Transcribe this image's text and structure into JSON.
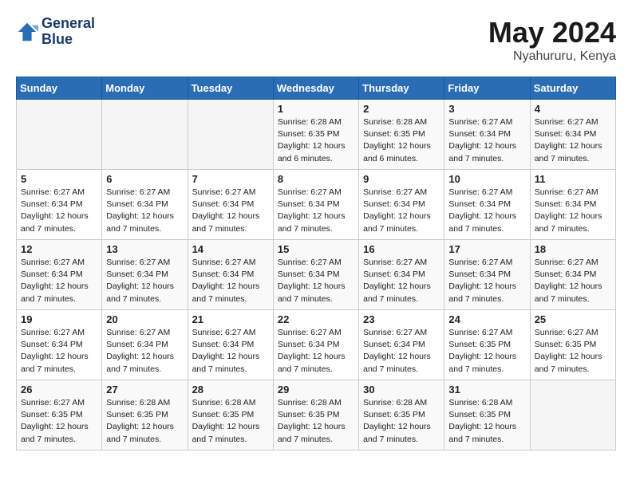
{
  "header": {
    "logo_line1": "General",
    "logo_line2": "Blue",
    "month": "May 2024",
    "location": "Nyahururu, Kenya"
  },
  "days_of_week": [
    "Sunday",
    "Monday",
    "Tuesday",
    "Wednesday",
    "Thursday",
    "Friday",
    "Saturday"
  ],
  "weeks": [
    [
      {
        "day": "",
        "content": ""
      },
      {
        "day": "",
        "content": ""
      },
      {
        "day": "",
        "content": ""
      },
      {
        "day": "1",
        "content": "Sunrise: 6:28 AM\nSunset: 6:35 PM\nDaylight: 12 hours\nand 6 minutes."
      },
      {
        "day": "2",
        "content": "Sunrise: 6:28 AM\nSunset: 6:35 PM\nDaylight: 12 hours\nand 6 minutes."
      },
      {
        "day": "3",
        "content": "Sunrise: 6:27 AM\nSunset: 6:34 PM\nDaylight: 12 hours\nand 7 minutes."
      },
      {
        "day": "4",
        "content": "Sunrise: 6:27 AM\nSunset: 6:34 PM\nDaylight: 12 hours\nand 7 minutes."
      }
    ],
    [
      {
        "day": "5",
        "content": "Sunrise: 6:27 AM\nSunset: 6:34 PM\nDaylight: 12 hours\nand 7 minutes."
      },
      {
        "day": "6",
        "content": "Sunrise: 6:27 AM\nSunset: 6:34 PM\nDaylight: 12 hours\nand 7 minutes."
      },
      {
        "day": "7",
        "content": "Sunrise: 6:27 AM\nSunset: 6:34 PM\nDaylight: 12 hours\nand 7 minutes."
      },
      {
        "day": "8",
        "content": "Sunrise: 6:27 AM\nSunset: 6:34 PM\nDaylight: 12 hours\nand 7 minutes."
      },
      {
        "day": "9",
        "content": "Sunrise: 6:27 AM\nSunset: 6:34 PM\nDaylight: 12 hours\nand 7 minutes."
      },
      {
        "day": "10",
        "content": "Sunrise: 6:27 AM\nSunset: 6:34 PM\nDaylight: 12 hours\nand 7 minutes."
      },
      {
        "day": "11",
        "content": "Sunrise: 6:27 AM\nSunset: 6:34 PM\nDaylight: 12 hours\nand 7 minutes."
      }
    ],
    [
      {
        "day": "12",
        "content": "Sunrise: 6:27 AM\nSunset: 6:34 PM\nDaylight: 12 hours\nand 7 minutes."
      },
      {
        "day": "13",
        "content": "Sunrise: 6:27 AM\nSunset: 6:34 PM\nDaylight: 12 hours\nand 7 minutes."
      },
      {
        "day": "14",
        "content": "Sunrise: 6:27 AM\nSunset: 6:34 PM\nDaylight: 12 hours\nand 7 minutes."
      },
      {
        "day": "15",
        "content": "Sunrise: 6:27 AM\nSunset: 6:34 PM\nDaylight: 12 hours\nand 7 minutes."
      },
      {
        "day": "16",
        "content": "Sunrise: 6:27 AM\nSunset: 6:34 PM\nDaylight: 12 hours\nand 7 minutes."
      },
      {
        "day": "17",
        "content": "Sunrise: 6:27 AM\nSunset: 6:34 PM\nDaylight: 12 hours\nand 7 minutes."
      },
      {
        "day": "18",
        "content": "Sunrise: 6:27 AM\nSunset: 6:34 PM\nDaylight: 12 hours\nand 7 minutes."
      }
    ],
    [
      {
        "day": "19",
        "content": "Sunrise: 6:27 AM\nSunset: 6:34 PM\nDaylight: 12 hours\nand 7 minutes."
      },
      {
        "day": "20",
        "content": "Sunrise: 6:27 AM\nSunset: 6:34 PM\nDaylight: 12 hours\nand 7 minutes."
      },
      {
        "day": "21",
        "content": "Sunrise: 6:27 AM\nSunset: 6:34 PM\nDaylight: 12 hours\nand 7 minutes."
      },
      {
        "day": "22",
        "content": "Sunrise: 6:27 AM\nSunset: 6:34 PM\nDaylight: 12 hours\nand 7 minutes."
      },
      {
        "day": "23",
        "content": "Sunrise: 6:27 AM\nSunset: 6:34 PM\nDaylight: 12 hours\nand 7 minutes."
      },
      {
        "day": "24",
        "content": "Sunrise: 6:27 AM\nSunset: 6:35 PM\nDaylight: 12 hours\nand 7 minutes."
      },
      {
        "day": "25",
        "content": "Sunrise: 6:27 AM\nSunset: 6:35 PM\nDaylight: 12 hours\nand 7 minutes."
      }
    ],
    [
      {
        "day": "26",
        "content": "Sunrise: 6:27 AM\nSunset: 6:35 PM\nDaylight: 12 hours\nand 7 minutes."
      },
      {
        "day": "27",
        "content": "Sunrise: 6:28 AM\nSunset: 6:35 PM\nDaylight: 12 hours\nand 7 minutes."
      },
      {
        "day": "28",
        "content": "Sunrise: 6:28 AM\nSunset: 6:35 PM\nDaylight: 12 hours\nand 7 minutes."
      },
      {
        "day": "29",
        "content": "Sunrise: 6:28 AM\nSunset: 6:35 PM\nDaylight: 12 hours\nand 7 minutes."
      },
      {
        "day": "30",
        "content": "Sunrise: 6:28 AM\nSunset: 6:35 PM\nDaylight: 12 hours\nand 7 minutes."
      },
      {
        "day": "31",
        "content": "Sunrise: 6:28 AM\nSunset: 6:35 PM\nDaylight: 12 hours\nand 7 minutes."
      },
      {
        "day": "",
        "content": ""
      }
    ]
  ]
}
